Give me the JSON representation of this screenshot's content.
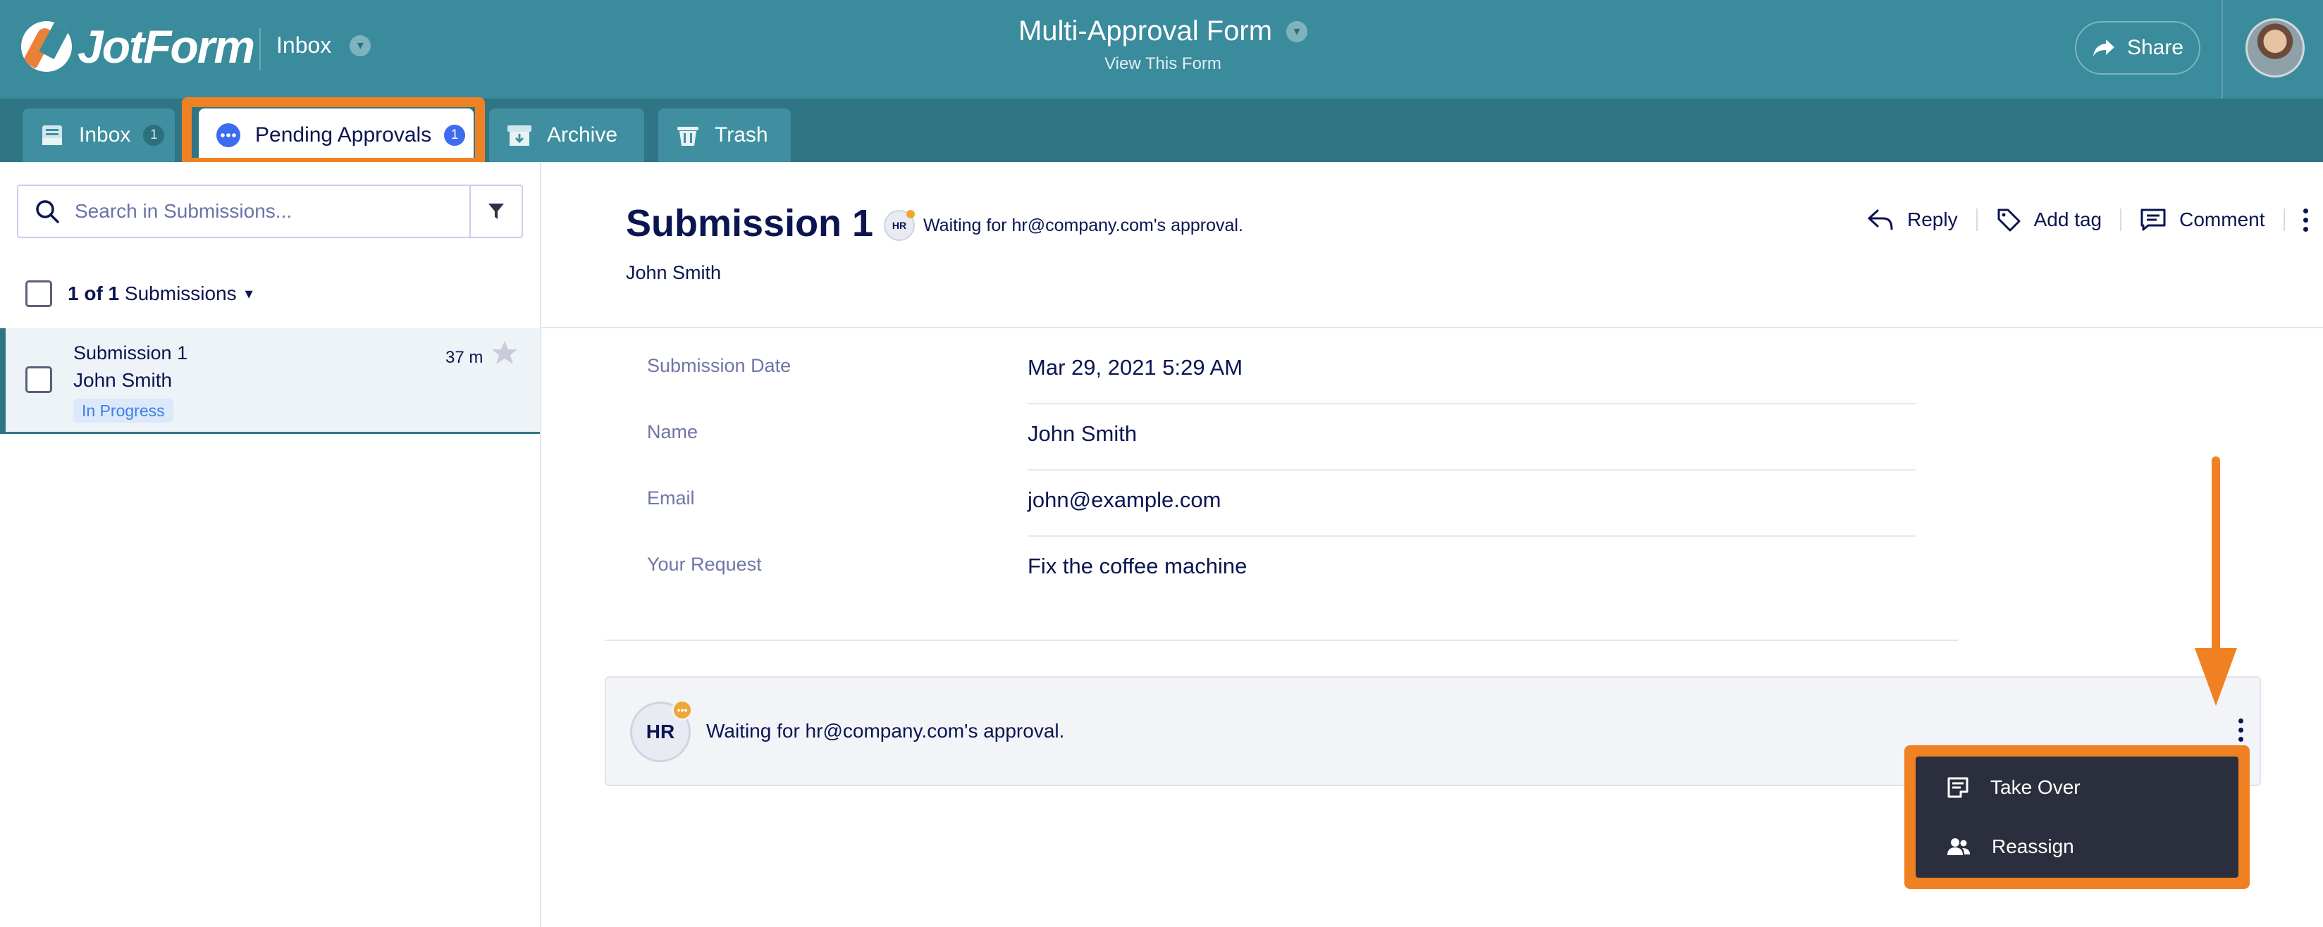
{
  "app": {
    "brand": "JotForm"
  },
  "header": {
    "inbox_selector": "Inbox",
    "form_title": "Multi-Approval Form",
    "view_form_link": "View This Form",
    "share_label": "Share"
  },
  "tabs": [
    {
      "label": "Inbox",
      "count": "1"
    },
    {
      "label": "Pending Approvals",
      "count": "1"
    },
    {
      "label": "Archive"
    },
    {
      "label": "Trash"
    }
  ],
  "sidebar": {
    "search_placeholder": "Search in Submissions...",
    "selection": {
      "count_text": "1 of 1",
      "suffix": "Submissions"
    },
    "items": [
      {
        "title": "Submission 1",
        "name": "John Smith",
        "status": "In Progress",
        "time": "37 m"
      }
    ]
  },
  "submission": {
    "title": "Submission 1",
    "approver_initials": "HR",
    "status_text": "Waiting for hr@company.com's approval.",
    "submitter": "John Smith",
    "actions": {
      "reply": "Reply",
      "add_tag": "Add tag",
      "comment": "Comment"
    },
    "fields": [
      {
        "label": "Submission Date",
        "value": "Mar 29, 2021 5:29 AM"
      },
      {
        "label": "Name",
        "value": "John Smith"
      },
      {
        "label": "Email",
        "value": "john@example.com"
      },
      {
        "label": "Your Request",
        "value": "Fix the coffee machine"
      }
    ]
  },
  "approval": {
    "initials": "HR",
    "text": "Waiting for hr@company.com's approval.",
    "menu": [
      {
        "label": "Take Over",
        "icon": "take-over-icon"
      },
      {
        "label": "Reassign",
        "icon": "people-icon"
      }
    ]
  },
  "colors": {
    "header_bg": "#3a8b9c",
    "tabs_bg": "#2f7584",
    "highlight": "#f08122",
    "navy_text": "#0a1551",
    "badge_blue": "#3d6cf0"
  }
}
